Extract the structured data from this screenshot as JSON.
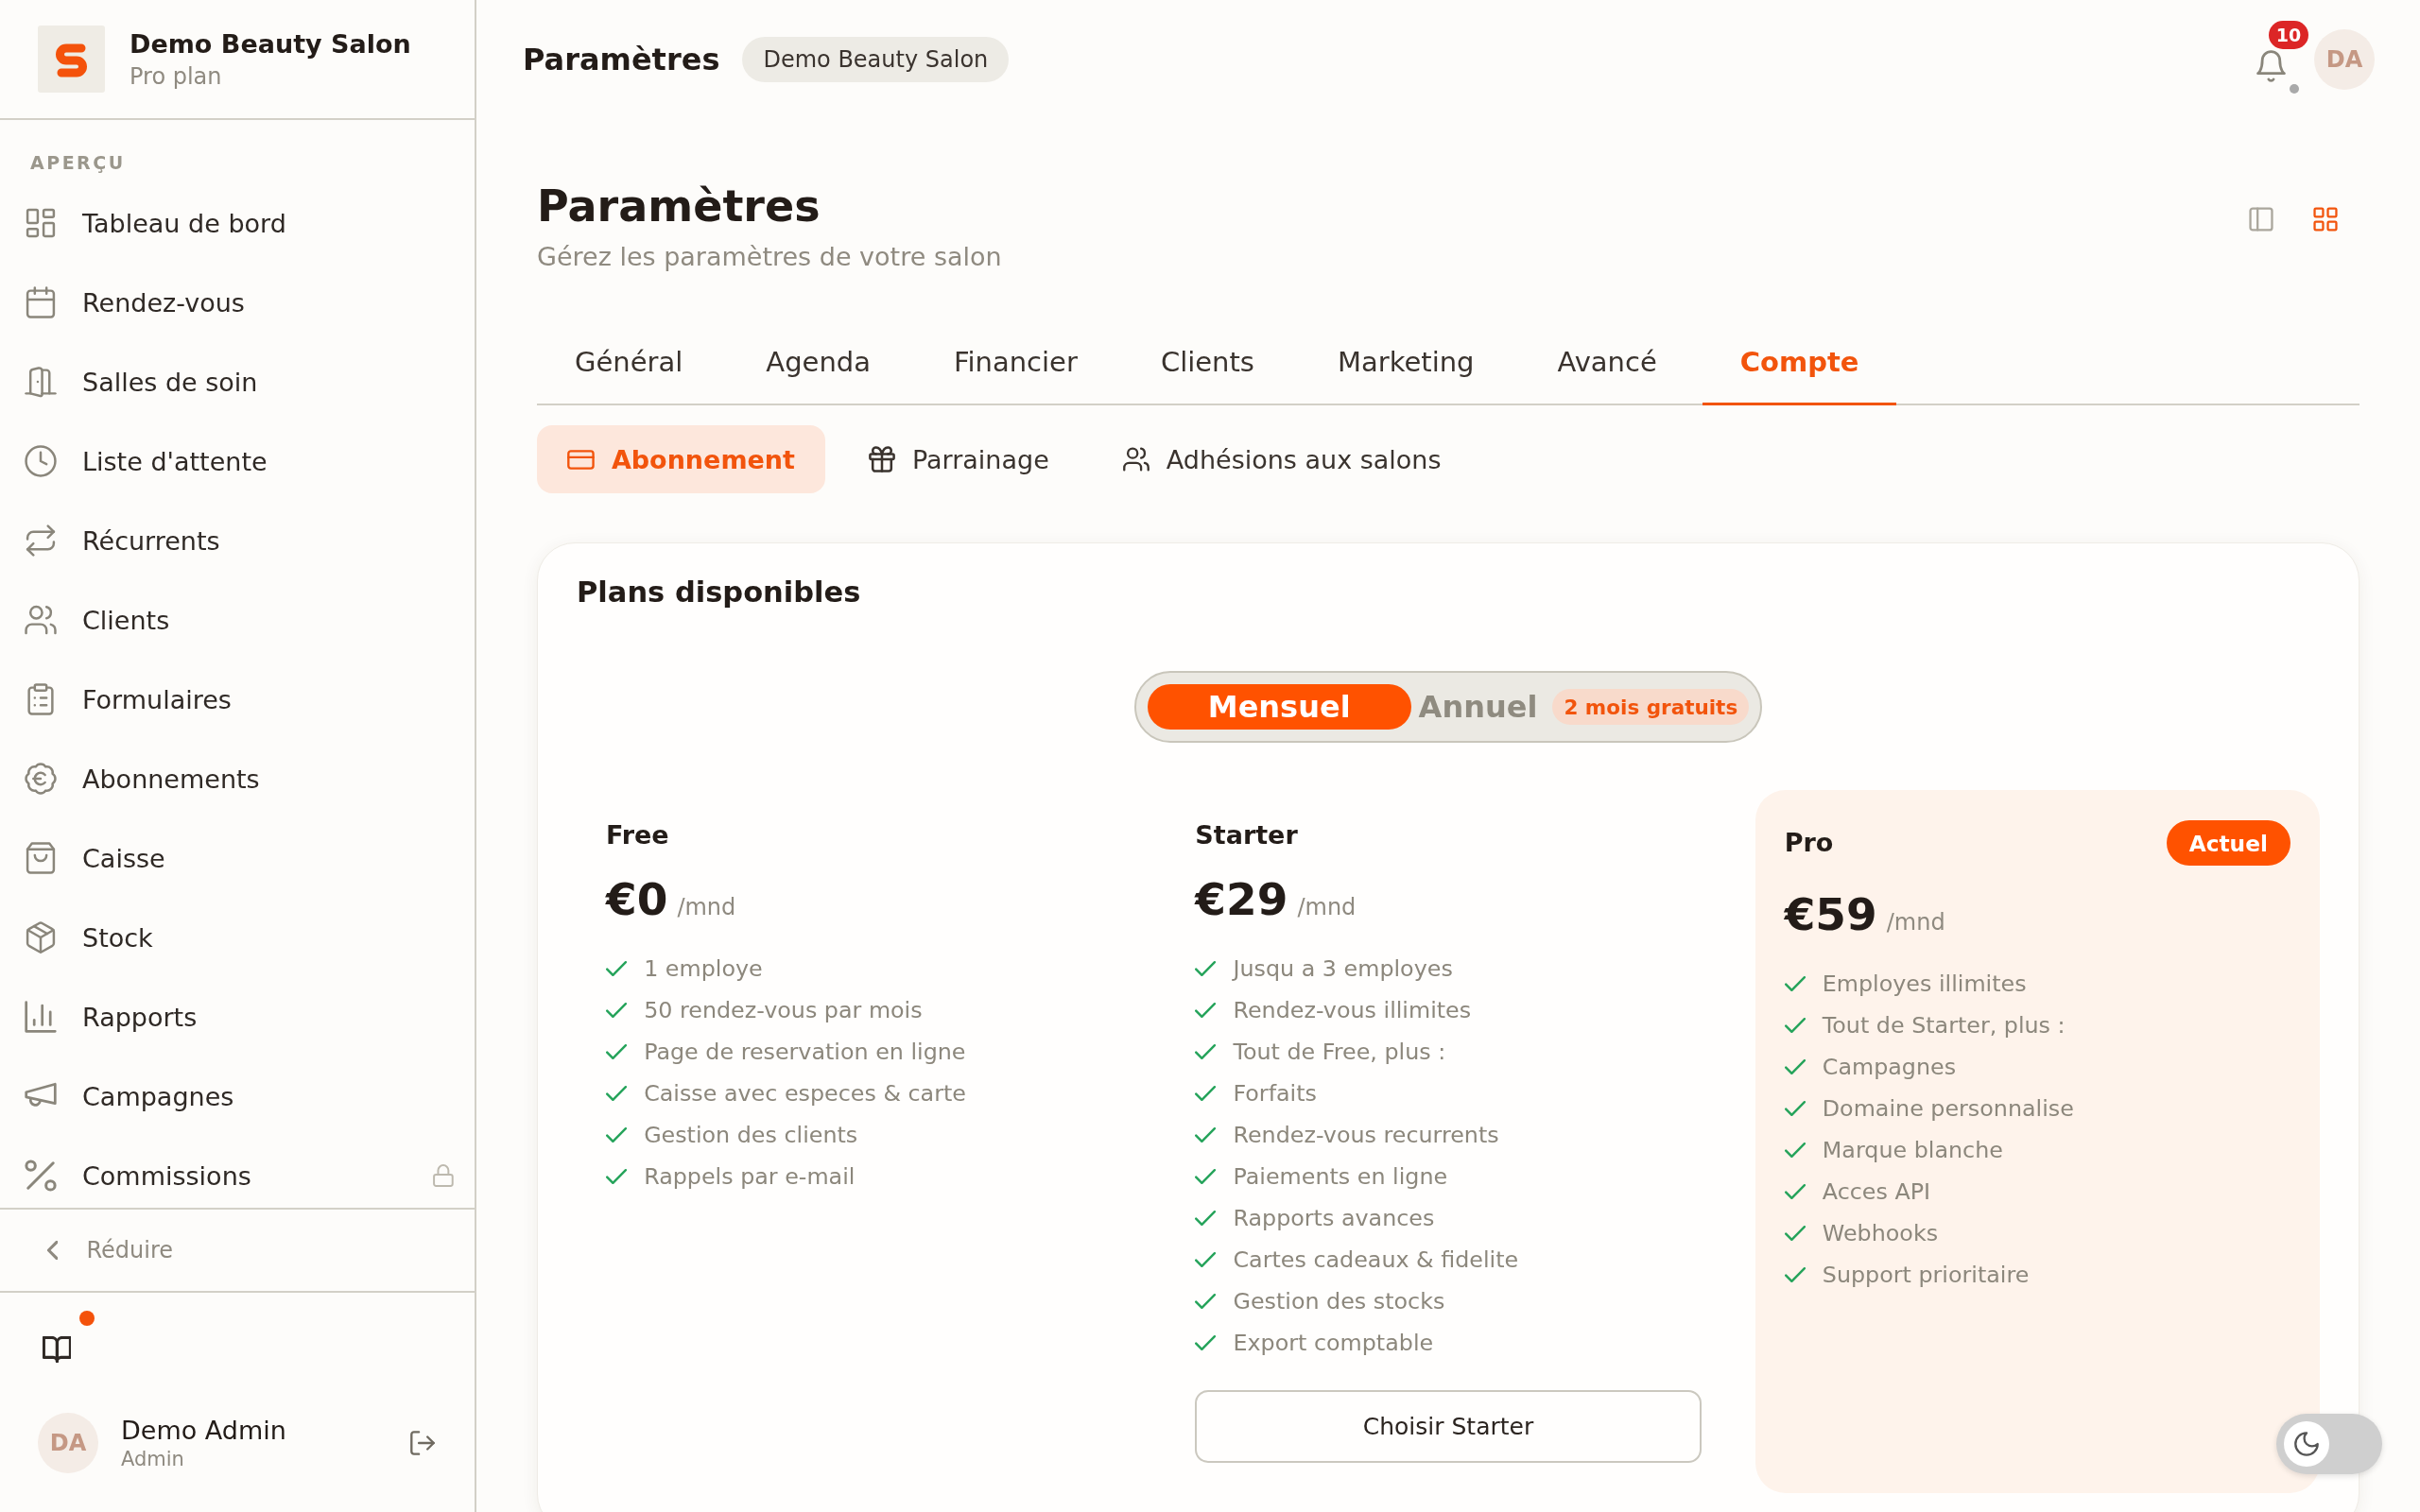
{
  "sidebar": {
    "brand": {
      "name": "Demo Beauty Salon",
      "plan": "Pro plan"
    },
    "section_label": "APERÇU",
    "items": [
      {
        "label": "Tableau de bord",
        "selected": false,
        "locked": false
      },
      {
        "label": "Rendez-vous",
        "selected": false,
        "locked": false
      },
      {
        "label": "Salles de soin",
        "selected": false,
        "locked": false
      },
      {
        "label": "Liste d'attente",
        "selected": false,
        "locked": false
      },
      {
        "label": "Récurrents",
        "selected": false,
        "locked": false
      },
      {
        "label": "Clients",
        "selected": false,
        "locked": false
      },
      {
        "label": "Formulaires",
        "selected": false,
        "locked": false
      },
      {
        "label": "Abonnements",
        "selected": false,
        "locked": false
      },
      {
        "label": "Caisse",
        "selected": false,
        "locked": false
      },
      {
        "label": "Stock",
        "selected": false,
        "locked": false
      },
      {
        "label": "Rapports",
        "selected": false,
        "locked": false
      },
      {
        "label": "Campagnes",
        "selected": false,
        "locked": false
      },
      {
        "label": "Commissions",
        "selected": false,
        "locked": true
      }
    ],
    "collapse_label": "Réduire",
    "guide": {
      "new": true
    },
    "user": {
      "initials": "DA",
      "name": "Demo Admin",
      "role": "Admin"
    }
  },
  "topbar": {
    "title": "Paramètres",
    "salon_badge": "Demo Beauty Salon",
    "notifications": {
      "count": "10",
      "indicator": true
    },
    "avatar_initials": "DA"
  },
  "page": {
    "title": "Paramètres",
    "subtitle": "Gérez les paramètres de votre salon",
    "view_options": [
      {
        "selected": false
      },
      {
        "selected": true
      }
    ]
  },
  "tabs": [
    {
      "label": "Général",
      "selected": false
    },
    {
      "label": "Agenda",
      "selected": false
    },
    {
      "label": "Financier",
      "selected": false
    },
    {
      "label": "Clients",
      "selected": false
    },
    {
      "label": "Marketing",
      "selected": false
    },
    {
      "label": "Avancé",
      "selected": false
    },
    {
      "label": "Compte",
      "selected": true
    }
  ],
  "subtabs": [
    {
      "label": "Abonnement",
      "selected": true
    },
    {
      "label": "Parrainage",
      "selected": false
    },
    {
      "label": "Adhésions aux salons",
      "selected": false
    }
  ],
  "plans_panel": {
    "title": "Plans disponibles",
    "billing_options": [
      {
        "label": "Mensuel",
        "selected": true
      },
      {
        "label": "Annuel",
        "selected": false,
        "badge": "2 mois gratuits"
      }
    ],
    "plans": [
      {
        "name": "Free",
        "price": "€0",
        "period": "/mnd",
        "current": false,
        "features": [
          "1 employe",
          "50 rendez-vous par mois",
          "Page de reservation en ligne",
          "Caisse avec especes & carte",
          "Gestion des clients",
          "Rappels par e-mail"
        ]
      },
      {
        "name": "Starter",
        "price": "€29",
        "period": "/mnd",
        "current": false,
        "features": [
          "Jusqu a 3 employes",
          "Rendez-vous illimites",
          "Tout de Free, plus :",
          "Forfaits",
          "Rendez-vous recurrents",
          "Paiements en ligne",
          "Rapports avances",
          "Cartes cadeaux & fidelite",
          "Gestion des stocks",
          "Export comptable"
        ],
        "button": "Choisir Starter"
      },
      {
        "name": "Pro",
        "price": "€59",
        "period": "/mnd",
        "current": true,
        "badge": "Actuel",
        "features": [
          "Employes illimites",
          "Tout de Starter, plus :",
          "Campagnes",
          "Domaine personnalise",
          "Marque blanche",
          "Acces API",
          "Webhooks",
          "Support prioritaire"
        ]
      }
    ]
  },
  "theme_toggle": {
    "on": false
  }
}
